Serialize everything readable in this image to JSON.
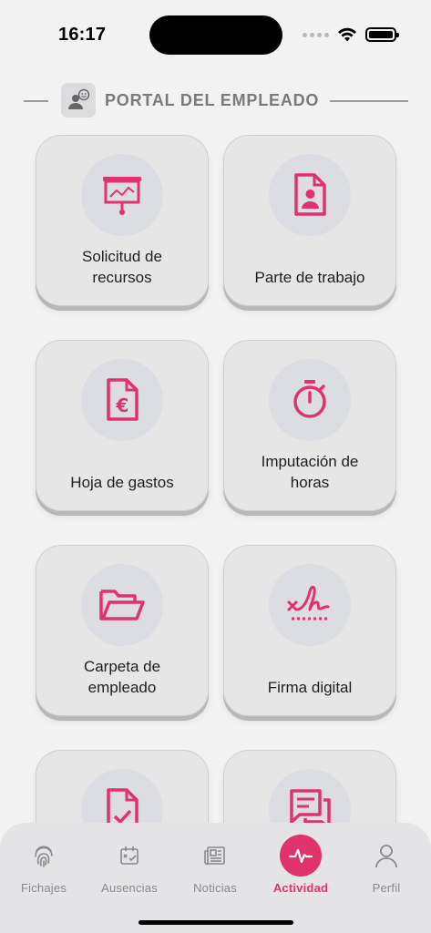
{
  "status_bar": {
    "time": "16:17"
  },
  "header": {
    "title": "PORTAL DEL EMPLEADO",
    "icon": "user-chat-icon"
  },
  "colors": {
    "accent": "#e0336b",
    "card_bg": "#e6e6e6",
    "icon_circle": "#dcdce3"
  },
  "cards": [
    {
      "label_line1": "Solicitud de",
      "label_line2": "recursos",
      "icon": "presentation-chart-icon"
    },
    {
      "label_line1": "Parte de trabajo",
      "label_line2": "",
      "icon": "document-person-icon"
    },
    {
      "label_line1": "Hoja de gastos",
      "label_line2": "",
      "icon": "document-euro-icon"
    },
    {
      "label_line1": "Imputación de",
      "label_line2": "horas",
      "icon": "stopwatch-icon"
    },
    {
      "label_line1": "Carpeta de",
      "label_line2": "empleado",
      "icon": "folder-open-icon"
    },
    {
      "label_line1": "Firma digital",
      "label_line2": "",
      "icon": "signature-icon"
    },
    {
      "label_line1": "",
      "label_line2": "",
      "icon": "document-check-icon"
    },
    {
      "label_line1": "",
      "label_line2": "",
      "icon": "chat-document-icon"
    }
  ],
  "nav": {
    "items": [
      {
        "label": "Fichajes",
        "icon": "fingerprint-icon"
      },
      {
        "label": "Ausencias",
        "icon": "calendar-check-icon"
      },
      {
        "label": "Noticias",
        "icon": "newspaper-icon"
      },
      {
        "label": "Actividad",
        "icon": "activity-icon"
      },
      {
        "label": "Perfil",
        "icon": "person-icon"
      }
    ],
    "active": "Actividad"
  }
}
